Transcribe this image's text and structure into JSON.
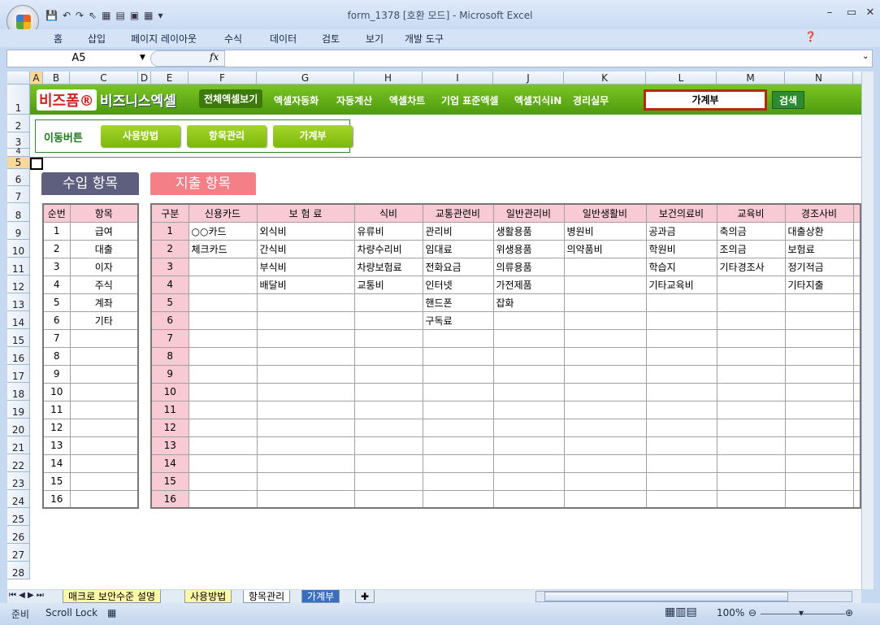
{
  "window": {
    "title": "form_1378  [호환 모드] - Microsoft Excel"
  },
  "ribbon_tabs": [
    "홈",
    "삽입",
    "페이지 레이아웃",
    "수식",
    "데이터",
    "검토",
    "보기",
    "개발 도구"
  ],
  "formula": {
    "name_box": "A5",
    "fx": "fx",
    "value": ""
  },
  "columns": [
    "A",
    "B",
    "C",
    "D",
    "E",
    "F",
    "G",
    "H",
    "I",
    "J",
    "K",
    "L",
    "M",
    "N"
  ],
  "rows": [
    "1",
    "2",
    "3",
    "4",
    "5",
    "6",
    "7",
    "8",
    "9",
    "10",
    "11",
    "12",
    "13",
    "14",
    "15",
    "16",
    "17",
    "18",
    "19",
    "20",
    "21",
    "22",
    "23",
    "24",
    "25",
    "26",
    "27",
    "28"
  ],
  "banner": {
    "logo1": "비즈폼®",
    "logo2": "비즈니스엑셀",
    "nav": [
      "전체엑셀보기",
      "엑셀자동화",
      "자동계산",
      "엑셀차트",
      "기업 표준엑셀",
      "엑셀지식iN",
      "경리실무"
    ],
    "search_value": "가계부",
    "search_button": "검색"
  },
  "move_buttons": {
    "label": "이동버튼",
    "buttons": [
      "사용방법",
      "항목관리",
      "가계부"
    ]
  },
  "income": {
    "title": "수입 항목",
    "headers": [
      "순번",
      "항목"
    ],
    "rows": [
      [
        "1",
        "급여"
      ],
      [
        "2",
        "대출"
      ],
      [
        "3",
        "이자"
      ],
      [
        "4",
        "주식"
      ],
      [
        "5",
        "계좌"
      ],
      [
        "6",
        "기타"
      ],
      [
        "7",
        ""
      ],
      [
        "8",
        ""
      ],
      [
        "9",
        ""
      ],
      [
        "10",
        ""
      ],
      [
        "11",
        ""
      ],
      [
        "12",
        ""
      ],
      [
        "13",
        ""
      ],
      [
        "14",
        ""
      ],
      [
        "15",
        ""
      ],
      [
        "16",
        ""
      ]
    ]
  },
  "expense": {
    "title": "지출 항목",
    "headers": [
      "구분",
      "신용카드",
      "보 험 료",
      "식비",
      "교통관련비",
      "일반관리비",
      "일반생활비",
      "보건의료비",
      "교육비",
      "경조사비"
    ],
    "rows": [
      [
        "1",
        "○○카드",
        "외식비",
        "유류비",
        "관리비",
        "생활용품",
        "병원비",
        "공과금",
        "축의금",
        "대출상환"
      ],
      [
        "2",
        "체크카드",
        "간식비",
        "차량수리비",
        "임대료",
        "위생용품",
        "의약품비",
        "학원비",
        "조의금",
        "보험료"
      ],
      [
        "3",
        "",
        "부식비",
        "차량보험료",
        "전화요금",
        "의류용품",
        "",
        "학습지",
        "기타경조사",
        "정기적금"
      ],
      [
        "4",
        "",
        "배달비",
        "교통비",
        "인터넷",
        "가전제품",
        "",
        "기타교육비",
        "",
        "기타지출"
      ],
      [
        "5",
        "",
        "",
        "",
        "핸드폰",
        "잡화",
        "",
        "",
        "",
        ""
      ],
      [
        "6",
        "",
        "",
        "",
        "구독료",
        "",
        "",
        "",
        "",
        ""
      ],
      [
        "7",
        "",
        "",
        "",
        "",
        "",
        "",
        "",
        "",
        ""
      ],
      [
        "8",
        "",
        "",
        "",
        "",
        "",
        "",
        "",
        "",
        ""
      ],
      [
        "9",
        "",
        "",
        "",
        "",
        "",
        "",
        "",
        "",
        ""
      ],
      [
        "10",
        "",
        "",
        "",
        "",
        "",
        "",
        "",
        "",
        ""
      ],
      [
        "11",
        "",
        "",
        "",
        "",
        "",
        "",
        "",
        "",
        ""
      ],
      [
        "12",
        "",
        "",
        "",
        "",
        "",
        "",
        "",
        "",
        ""
      ],
      [
        "13",
        "",
        "",
        "",
        "",
        "",
        "",
        "",
        "",
        ""
      ],
      [
        "14",
        "",
        "",
        "",
        "",
        "",
        "",
        "",
        "",
        ""
      ],
      [
        "15",
        "",
        "",
        "",
        "",
        "",
        "",
        "",
        "",
        ""
      ],
      [
        "16",
        "",
        "",
        "",
        "",
        "",
        "",
        "",
        "",
        ""
      ]
    ]
  },
  "sheet_tabs": [
    "매크로 보안수준 설명",
    "사용방법",
    "항목관리",
    "가계부"
  ],
  "active_sheet": "항목관리",
  "status": {
    "ready": "준비",
    "scroll_lock": "Scroll Lock",
    "zoom": "100%"
  }
}
